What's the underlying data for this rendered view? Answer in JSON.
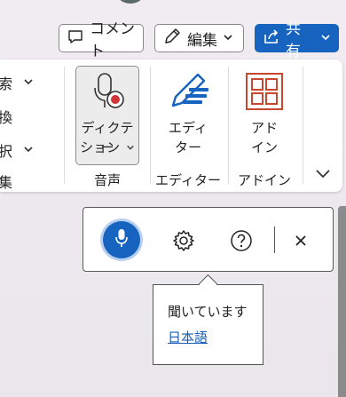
{
  "header": {
    "comment_label": "コメント",
    "edit_label": "編集",
    "share_label": "共有"
  },
  "ribbon": {
    "partial_items": [
      "索",
      "換",
      "択",
      "集"
    ],
    "dictation": {
      "line1": "ディクテー",
      "line2": "ション",
      "group_label": "音声"
    },
    "editor": {
      "line1": "エディ",
      "line2": "ター",
      "group_label": "エディター"
    },
    "addins": {
      "line1": "アド",
      "line2": "イン",
      "group_label": "アドイン"
    }
  },
  "dictation_toolbar": {
    "tooltip": {
      "status": "聞いています",
      "language": "日本語"
    }
  },
  "colors": {
    "accent": "#1664c0",
    "record_red": "#d13438",
    "addins_orange": "#c8472e"
  }
}
